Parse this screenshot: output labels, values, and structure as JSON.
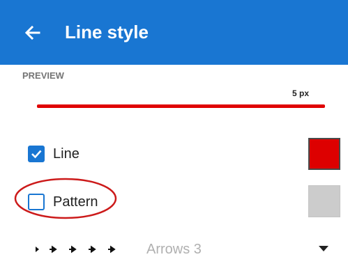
{
  "colors": {
    "appbar": "#1976d2",
    "preview_line": "#e00000",
    "line_swatch": "#dd0000",
    "pattern_swatch": "#cccccc",
    "highlight": "#cc1a1a"
  },
  "header": {
    "title": "Line style",
    "back_icon": "arrow-left-icon"
  },
  "preview": {
    "label": "PREVIEW",
    "width_label": "5 px"
  },
  "options": {
    "line": {
      "label": "Line",
      "checked": true,
      "color": "#dd0000"
    },
    "pattern": {
      "label": "Pattern",
      "checked": false,
      "color": "#cccccc"
    }
  },
  "arrows": {
    "value": "Arrows 3",
    "preview_icon": "arrow-pattern-icon",
    "dropdown_icon": "caret-down-icon"
  }
}
